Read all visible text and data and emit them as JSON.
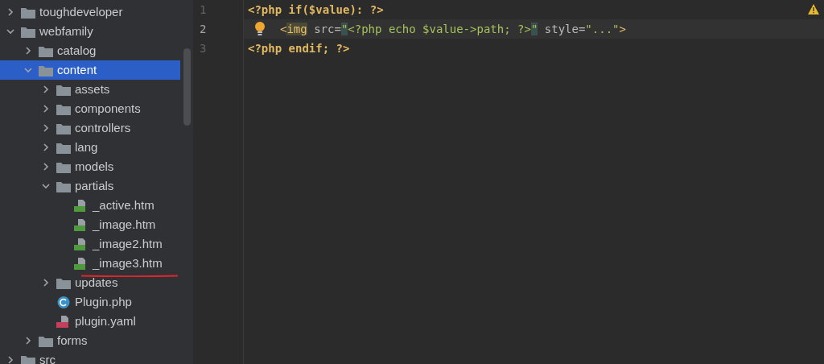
{
  "tree": [
    {
      "label": "toughdeveloper",
      "kind": "folder",
      "expanded": false,
      "selected": false
    },
    {
      "label": "webfamily",
      "kind": "folder",
      "expanded": true,
      "selected": false,
      "children": [
        {
          "label": "catalog",
          "kind": "folder",
          "expanded": false,
          "selected": false
        },
        {
          "label": "content",
          "kind": "folder",
          "expanded": true,
          "selected": true,
          "children": [
            {
              "label": "assets",
              "kind": "folder",
              "expanded": false,
              "selected": false
            },
            {
              "label": "components",
              "kind": "folder",
              "expanded": false,
              "selected": false
            },
            {
              "label": "controllers",
              "kind": "folder",
              "expanded": false,
              "selected": false
            },
            {
              "label": "lang",
              "kind": "folder",
              "expanded": false,
              "selected": false
            },
            {
              "label": "models",
              "kind": "folder",
              "expanded": false,
              "selected": false
            },
            {
              "label": "partials",
              "kind": "folder",
              "expanded": true,
              "selected": false,
              "children": [
                {
                  "label": "_active.htm",
                  "kind": "html-file",
                  "selected": false,
                  "underlined": false
                },
                {
                  "label": "_image.htm",
                  "kind": "html-file",
                  "selected": false,
                  "underlined": false
                },
                {
                  "label": "_image2.htm",
                  "kind": "html-file",
                  "selected": false,
                  "underlined": false
                },
                {
                  "label": "_image3.htm",
                  "kind": "html-file",
                  "selected": false,
                  "underlined": true
                }
              ]
            },
            {
              "label": "updates",
              "kind": "folder",
              "expanded": false,
              "selected": false
            },
            {
              "label": "Plugin.php",
              "kind": "php-class",
              "selected": false
            },
            {
              "label": "plugin.yaml",
              "kind": "yaml-file",
              "selected": false
            }
          ]
        },
        {
          "label": "forms",
          "kind": "folder",
          "expanded": false,
          "selected": false
        }
      ]
    },
    {
      "label": "src",
      "kind": "folder",
      "expanded": false,
      "selected": false
    }
  ],
  "editor": {
    "warning": true,
    "lines": [
      {
        "number": "1",
        "current": false,
        "bulb": false,
        "tokens": [
          {
            "text": "<?php if($value): ?>",
            "kind": "php"
          }
        ]
      },
      {
        "number": "2",
        "current": true,
        "bulb": true,
        "tokens": [
          {
            "text": "<",
            "kind": "tag"
          },
          {
            "text": "img",
            "kind": "tag",
            "highlight": true
          },
          {
            "text": " src=",
            "kind": "attr"
          },
          {
            "text": "\"",
            "kind": "string",
            "highlight": true
          },
          {
            "text": "<?php echo $value->path; ?>",
            "kind": "string"
          },
          {
            "text": "\"",
            "kind": "string",
            "highlight": true
          },
          {
            "text": " style=",
            "kind": "attr"
          },
          {
            "text": "\"...\"",
            "kind": "string"
          },
          {
            "text": ">",
            "kind": "tag"
          }
        ]
      },
      {
        "number": "3",
        "current": false,
        "bulb": false,
        "tokens": [
          {
            "text": "<?php endif; ?>",
            "kind": "php"
          }
        ]
      }
    ]
  }
}
